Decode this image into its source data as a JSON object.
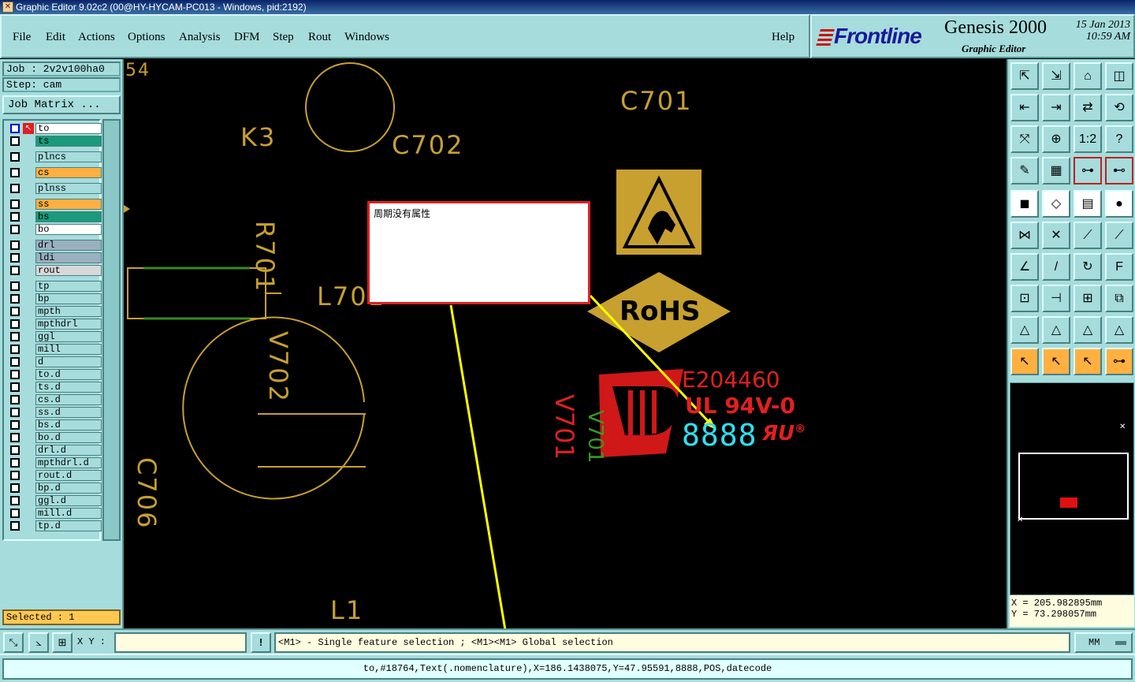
{
  "window": {
    "title": "Graphic Editor 9.02c2 (00@HY-HYCAM-PC013 - Windows, pid:2192)"
  },
  "menu": {
    "items": [
      {
        "label": "File"
      },
      {
        "label": "Edit"
      },
      {
        "label": "Actions"
      },
      {
        "label": "Options"
      },
      {
        "label": "Analysis"
      },
      {
        "label": "DFM"
      },
      {
        "label": "Step"
      },
      {
        "label": "Rout"
      },
      {
        "label": "Windows"
      }
    ],
    "help": "Help"
  },
  "brand": {
    "logo": "Frontline",
    "product": "Genesis 2000",
    "subtitle": "Graphic Editor",
    "date": "15 Jan 2013",
    "time": "10:59 AM"
  },
  "job": {
    "job_label": "Job : 2v2v100ha0",
    "step_label": "Step: cam",
    "matrix_button": "Job Matrix ..."
  },
  "layers": [
    {
      "name": "to",
      "bg": "#ffffff",
      "active": true
    },
    {
      "name": "ts",
      "bg": "#1a9a7a"
    },
    {
      "name": "plncs",
      "bg": "#a6dcdc"
    },
    {
      "name": "cs",
      "bg": "#ffb040"
    },
    {
      "name": "plnss",
      "bg": "#a6dcdc"
    },
    {
      "name": "ss",
      "bg": "#ffb040"
    },
    {
      "name": "bs",
      "bg": "#1a9a7a"
    },
    {
      "name": "bo",
      "bg": "#ffffff"
    },
    {
      "name": "drl",
      "bg": "#9ab0c0"
    },
    {
      "name": "ldi",
      "bg": "#9ab0c0"
    },
    {
      "name": "rout",
      "bg": "#d8d8d8"
    },
    {
      "name": "tp",
      "bg": "#a6dcdc"
    },
    {
      "name": "bp",
      "bg": "#a6dcdc"
    },
    {
      "name": "mpth",
      "bg": "#a6dcdc"
    },
    {
      "name": "mpthdrl",
      "bg": "#a6dcdc"
    },
    {
      "name": "ggl",
      "bg": "#a6dcdc"
    },
    {
      "name": "mill",
      "bg": "#a6dcdc"
    },
    {
      "name": "d",
      "bg": "#a6dcdc"
    },
    {
      "name": "to.d",
      "bg": "#a6dcdc"
    },
    {
      "name": "ts.d",
      "bg": "#a6dcdc"
    },
    {
      "name": "cs.d",
      "bg": "#a6dcdc"
    },
    {
      "name": "ss.d",
      "bg": "#a6dcdc"
    },
    {
      "name": "bs.d",
      "bg": "#a6dcdc"
    },
    {
      "name": "bo.d",
      "bg": "#a6dcdc"
    },
    {
      "name": "drl.d",
      "bg": "#a6dcdc"
    },
    {
      "name": "mpthdrl.d",
      "bg": "#a6dcdc"
    },
    {
      "name": "rout.d",
      "bg": "#a6dcdc"
    },
    {
      "name": "bp.d",
      "bg": "#a6dcdc"
    },
    {
      "name": "ggl.d",
      "bg": "#a6dcdc"
    },
    {
      "name": "mill.d",
      "bg": "#a6dcdc"
    },
    {
      "name": "tp.d",
      "bg": "#a6dcdc"
    }
  ],
  "selected": "Selected : 1",
  "canvas": {
    "labels": {
      "corner": "54",
      "c701": "C701",
      "c702": "C702",
      "k3": "K3",
      "r701": "R701",
      "l701": "L701",
      "v702": "V702",
      "c706": "C706",
      "l1": "L1",
      "rohs": "RoHS",
      "ul_number": "E204460",
      "ul_rating": "UL 94V-0",
      "datecode": "8888",
      "v701": "V701"
    },
    "popup_text": "周期没有属性"
  },
  "coords": {
    "x": "X = 205.982895mm",
    "y": "Y = 73.298057mm"
  },
  "status": {
    "xy_label": "X Y :",
    "xy_value": "",
    "message": "<M1> - Single feature selection ; <M1><M1> Global selection",
    "units": "MM"
  },
  "bottom": {
    "feature_info": "to,#18764,Text(.nomenclature),X=186.1438075,Y=47.95591,8888,POS,datecode"
  }
}
